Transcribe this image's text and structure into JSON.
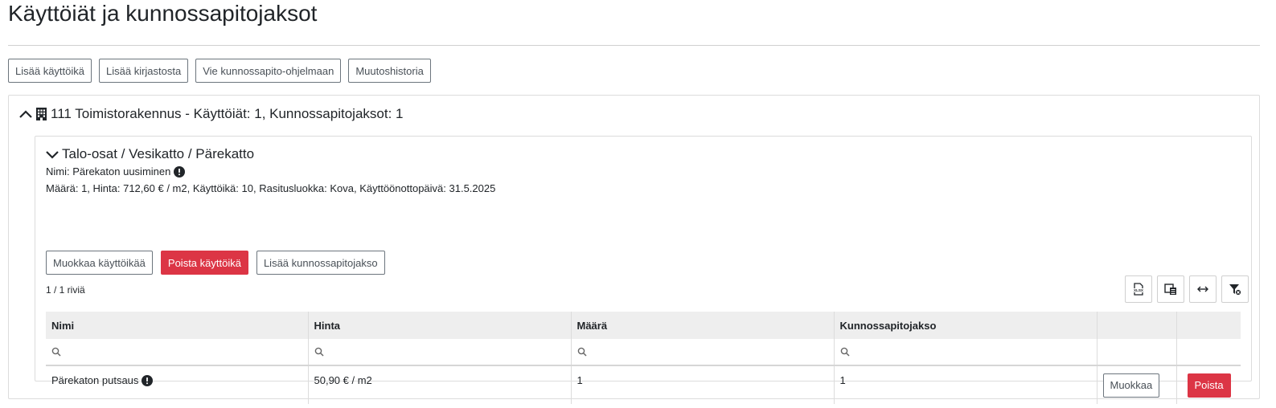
{
  "page": {
    "title": "Käyttöiät ja kunnossapitojaksot"
  },
  "toolbar": {
    "add_lifespan": "Lisää käyttöikä",
    "add_from_library": "Lisää kirjastosta",
    "export_maintenance": "Vie kunnossapito-ohjelmaan",
    "change_history": "Muutoshistoria"
  },
  "building": {
    "header": "111 Toimistorakennus - Käyttöiät: 1, Kunnossapitojaksot: 1"
  },
  "component": {
    "path": "Talo-osat / Vesikatto / Pärekatto",
    "name_line": "Nimi: Pärekaton uusiminen",
    "details": "Määrä: 1, Hinta: 712,60 € / m2, Käyttöikä: 10, Rasitusluokka: Kova, Käyttöönottopäivä: 31.5.2025",
    "edit_label": "Muokkaa käyttöikää",
    "delete_label": "Poista käyttöikä",
    "add_period_label": "Lisää kunnossapitojakso"
  },
  "table": {
    "row_count": "1 / 1 riviä",
    "columns": [
      "Nimi",
      "Hinta",
      "Määrä",
      "Kunnossapitojakso"
    ],
    "rows": [
      {
        "name": "Pärekaton putsaus",
        "price": "50,90 € / m2",
        "quantity": "1",
        "period": "1",
        "edit_label": "Muokkaa",
        "delete_label": "Poista"
      }
    ],
    "tools": [
      "xlsx-export-icon",
      "column-chooser-icon",
      "fit-columns-icon",
      "clear-filter-icon"
    ]
  },
  "colors": {
    "danger": "#dc3545",
    "header_bg": "#eeeeee",
    "border": "#dcdcdc"
  }
}
